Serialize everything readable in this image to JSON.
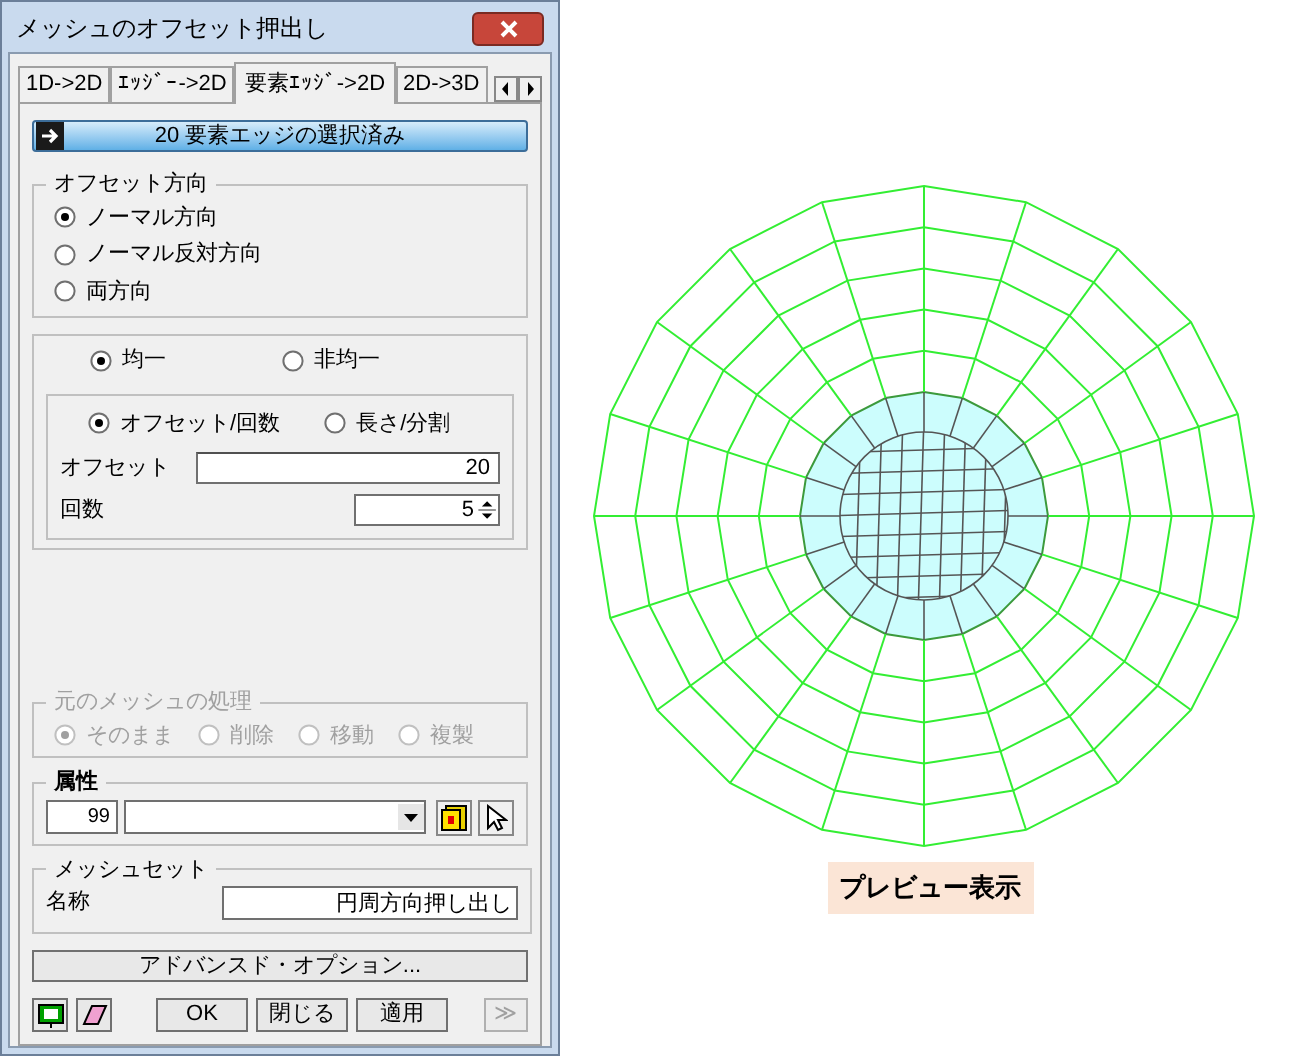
{
  "window": {
    "title": "メッシュのオフセット押出し"
  },
  "tabs": [
    {
      "label": "1D->2D",
      "selected": false
    },
    {
      "label": "ｴｯｼﾞｰ->2D",
      "selected": false
    },
    {
      "label": "要素ｴｯｼﾞ->2D",
      "selected": true
    },
    {
      "label": "2D->3D",
      "selected": false
    }
  ],
  "selection_button": {
    "label": "20 要素エッジの選択済み"
  },
  "offset_direction": {
    "title": "オフセット方向",
    "options": [
      {
        "label": "ノーマル方向",
        "selected": true
      },
      {
        "label": "ノーマル反対方向",
        "selected": false
      },
      {
        "label": "両方向",
        "selected": false
      }
    ]
  },
  "distribution": {
    "options": [
      {
        "label": "均一",
        "selected": true
      },
      {
        "label": "非均一",
        "selected": false
      }
    ],
    "mode_options": [
      {
        "label": "オフセット/回数",
        "selected": true
      },
      {
        "label": "長さ/分割",
        "selected": false
      }
    ],
    "offset": {
      "label": "オフセット",
      "value": "20"
    },
    "count": {
      "label": "回数",
      "value": "5"
    }
  },
  "original_mesh": {
    "title": "元のメッシュの処理",
    "disabled": true,
    "options": [
      {
        "label": "そのまま",
        "selected": true
      },
      {
        "label": "削除",
        "selected": false
      },
      {
        "label": "移動",
        "selected": false
      },
      {
        "label": "複製",
        "selected": false
      }
    ]
  },
  "attribute": {
    "title": "属性",
    "id": "99"
  },
  "mesh_set": {
    "title": "メッシュセット",
    "name_label": "名称",
    "name_value": "円周方向押し出し"
  },
  "advanced_button": "アドバンスド・オプション...",
  "buttons": [
    "OK",
    "閉じる",
    "適用"
  ],
  "more_button": "≫",
  "preview_label": "プレビュー表示"
}
